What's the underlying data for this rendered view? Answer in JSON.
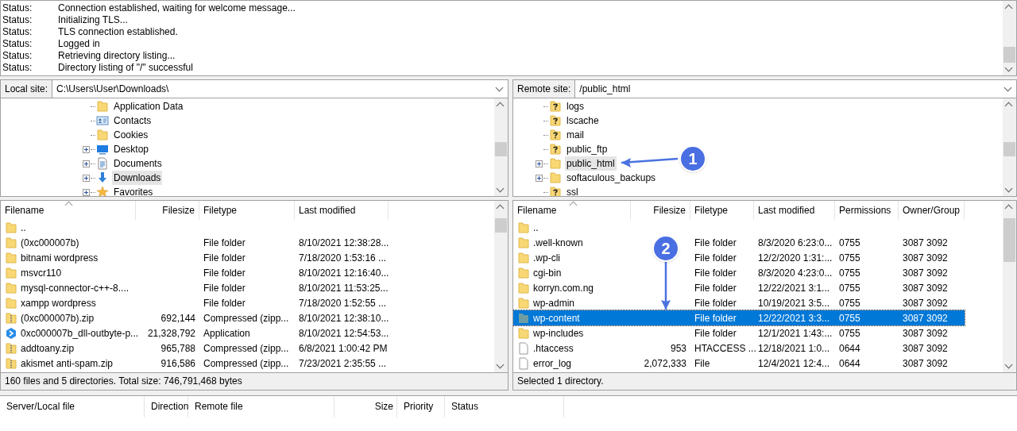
{
  "message_log": [
    {
      "type": "Status:",
      "message": "Connection established, waiting for welcome message..."
    },
    {
      "type": "Status:",
      "message": "Initializing TLS..."
    },
    {
      "type": "Status:",
      "message": "TLS connection established."
    },
    {
      "type": "Status:",
      "message": "Logged in"
    },
    {
      "type": "Status:",
      "message": "Retrieving directory listing..."
    },
    {
      "type": "Status:",
      "message": "Directory listing of \"/\" successful"
    }
  ],
  "local": {
    "site_label": "Local site:",
    "path": "C:\\Users\\User\\Downloads\\",
    "tree": [
      {
        "name": "Application Data",
        "kind": "folder",
        "expandable": false,
        "selected": false
      },
      {
        "name": "Contacts",
        "kind": "contacts",
        "expandable": false,
        "selected": false
      },
      {
        "name": "Cookies",
        "kind": "folder",
        "expandable": false,
        "selected": false
      },
      {
        "name": "Desktop",
        "kind": "desktop",
        "expandable": true,
        "selected": false
      },
      {
        "name": "Documents",
        "kind": "documents",
        "expandable": true,
        "selected": false
      },
      {
        "name": "Downloads",
        "kind": "download",
        "expandable": true,
        "selected": true
      },
      {
        "name": "Favorites",
        "kind": "star",
        "expandable": true,
        "selected": false
      }
    ],
    "columns": [
      "Filename",
      "Filesize",
      "Filetype",
      "Last modified"
    ],
    "files": [
      {
        "kind": "folder",
        "cells": [
          ".."
        ],
        "selected": false
      },
      {
        "kind": "folder",
        "cells": [
          "(0xc000007b)",
          "",
          "File folder",
          "8/10/2021 12:38:28..."
        ],
        "selected": false
      },
      {
        "kind": "folder",
        "cells": [
          "bitnami wordpress",
          "",
          "File folder",
          "7/18/2020 1:53:16 ..."
        ],
        "selected": false
      },
      {
        "kind": "folder",
        "cells": [
          "msvcr110",
          "",
          "File folder",
          "8/10/2021 12:16:40..."
        ],
        "selected": false
      },
      {
        "kind": "folder",
        "cells": [
          "mysql-connector-c++-8....",
          "",
          "File folder",
          "8/10/2021 11:53:25..."
        ],
        "selected": false
      },
      {
        "kind": "folder",
        "cells": [
          "xampp wordpress",
          "",
          "File folder",
          "7/18/2020 1:52:55 ..."
        ],
        "selected": false
      },
      {
        "kind": "zip",
        "cells": [
          "(0xc000007b).zip",
          "692,144",
          "Compressed (zipp...",
          "8/10/2021 12:38:10..."
        ],
        "selected": false
      },
      {
        "kind": "app",
        "cells": [
          "0xc000007b_dll-outbyte-p...",
          "21,328,792",
          "Application",
          "8/10/2021 12:54:53..."
        ],
        "selected": false
      },
      {
        "kind": "zip",
        "cells": [
          "addtoany.zip",
          "965,788",
          "Compressed (zipp...",
          "6/8/2021 1:00:42 PM"
        ],
        "selected": false
      },
      {
        "kind": "zip",
        "cells": [
          "akismet anti-spam.zip",
          "916,586",
          "Compressed (zipp...",
          "7/23/2021 2:35:55 ..."
        ],
        "selected": false
      }
    ],
    "status": "160 files and 5 directories. Total size: 746,791,468 bytes"
  },
  "remote": {
    "site_label": "Remote site:",
    "path": "/public_html",
    "tree": [
      {
        "name": "logs",
        "kind": "unknown",
        "expandable": false,
        "selected": false
      },
      {
        "name": "lscache",
        "kind": "unknown",
        "expandable": false,
        "selected": false
      },
      {
        "name": "mail",
        "kind": "unknown",
        "expandable": false,
        "selected": false
      },
      {
        "name": "public_ftp",
        "kind": "unknown",
        "expandable": false,
        "selected": false
      },
      {
        "name": "public_html",
        "kind": "folder",
        "expandable": true,
        "selected": true
      },
      {
        "name": "softaculous_backups",
        "kind": "folder",
        "expandable": true,
        "selected": false
      },
      {
        "name": "ssl",
        "kind": "unknown",
        "expandable": false,
        "selected": false
      }
    ],
    "columns": [
      "Filename",
      "Filesize",
      "Filetype",
      "Last modified",
      "Permissions",
      "Owner/Group"
    ],
    "files": [
      {
        "kind": "folder",
        "cells": [
          ".."
        ],
        "selected": false
      },
      {
        "kind": "folder",
        "cells": [
          ".well-known",
          "",
          "File folder",
          "8/3/2020 6:23:0...",
          "0755",
          "3087 3092"
        ],
        "selected": false
      },
      {
        "kind": "folder",
        "cells": [
          ".wp-cli",
          "",
          "File folder",
          "12/2/2020 1:31:...",
          "0755",
          "3087 3092"
        ],
        "selected": false
      },
      {
        "kind": "folder",
        "cells": [
          "cgi-bin",
          "",
          "File folder",
          "8/3/2020 4:23:0...",
          "0755",
          "3087 3092"
        ],
        "selected": false
      },
      {
        "kind": "folder",
        "cells": [
          "korryn.com.ng",
          "",
          "File folder",
          "12/22/2021 3:1...",
          "0755",
          "3087 3092"
        ],
        "selected": false
      },
      {
        "kind": "folder",
        "cells": [
          "wp-admin",
          "",
          "File folder",
          "10/19/2021 3:5...",
          "0755",
          "3087 3092"
        ],
        "selected": false
      },
      {
        "kind": "folder",
        "cells": [
          "wp-content",
          "",
          "File folder",
          "12/22/2021 3:3...",
          "0755",
          "3087 3092"
        ],
        "selected": true
      },
      {
        "kind": "folder",
        "cells": [
          "wp-includes",
          "",
          "File folder",
          "12/1/2021 1:43:...",
          "0755",
          "3087 3092"
        ],
        "selected": false
      },
      {
        "kind": "file",
        "cells": [
          ".htaccess",
          "953",
          "HTACCESS ...",
          "12/18/2021 1:0...",
          "0644",
          "3087 3092"
        ],
        "selected": false
      },
      {
        "kind": "file",
        "cells": [
          "error_log",
          "2,072,333",
          "File",
          "12/4/2021 12:4...",
          "0644",
          "3087 3092"
        ],
        "selected": false
      }
    ],
    "status": "Selected 1 directory."
  },
  "queue": {
    "columns": [
      "Server/Local file",
      "Direction",
      "Remote file",
      "Size",
      "Priority",
      "Status"
    ]
  },
  "annotations": [
    {
      "label": "1",
      "kind": "leftward"
    },
    {
      "label": "2",
      "kind": "downward"
    }
  ]
}
